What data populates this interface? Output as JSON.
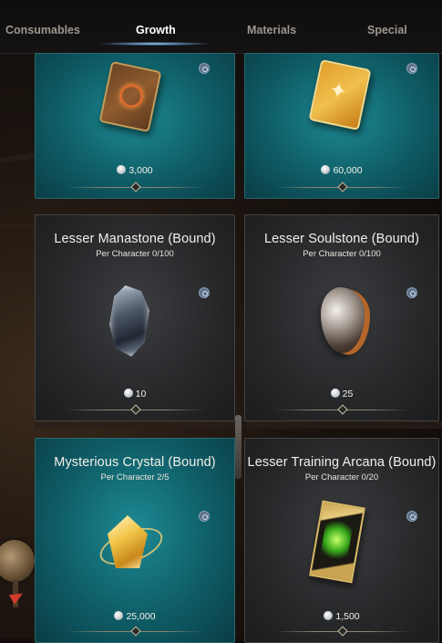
{
  "tabs": [
    {
      "label": "Consumables"
    },
    {
      "label": "Growth"
    },
    {
      "label": "Materials"
    },
    {
      "label": "Special"
    }
  ],
  "active_tab": "Growth",
  "cards": [
    {
      "title": "",
      "limit": "",
      "price": "3,000",
      "style": "teal",
      "icon": "tome-icon"
    },
    {
      "title": "",
      "limit": "",
      "price": "60,000",
      "style": "teal",
      "icon": "tome-icon"
    },
    {
      "title": "Lesser Manastone (Bound)",
      "limit": "Per Character  0/100",
      "price": "10",
      "style": "dark",
      "icon": "manastone-icon"
    },
    {
      "title": "Lesser Soulstone (Bound)",
      "limit": "Per Character  0/100",
      "price": "25",
      "style": "dark",
      "icon": "soulstone-icon"
    },
    {
      "title": "Mysterious Crystal (Bound)",
      "limit": "Per Character  2/5",
      "price": "25,000",
      "style": "teal",
      "icon": "crystal-icon"
    },
    {
      "title": "Lesser Training Arcana (Bound)",
      "limit": "Per Character  0/20",
      "price": "1,500",
      "style": "dark",
      "icon": "arcana-card-icon"
    }
  ],
  "icons": {
    "zoom": "magnifier-icon",
    "currency": "silver-coin-icon"
  },
  "colors": {
    "teal_card": "#0f5d67",
    "dark_card": "#262729",
    "active_tab_glow": "#9fd6ff"
  }
}
